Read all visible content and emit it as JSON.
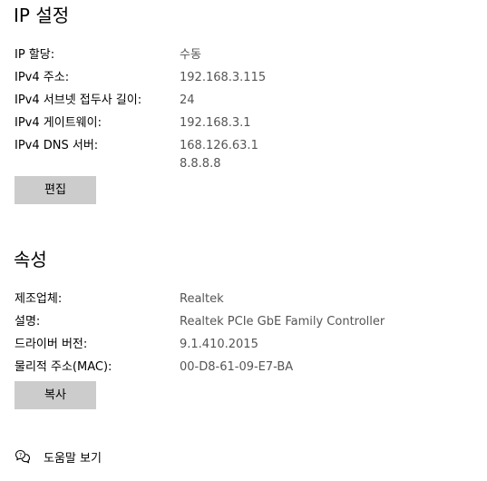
{
  "ip_settings": {
    "title": "IP 설정",
    "rows": [
      {
        "label": "IP 할당:",
        "value": "수동"
      },
      {
        "label": "IPv4 주소:",
        "value": "192.168.3.115"
      },
      {
        "label": "IPv4 서브넷 접두사 길이:",
        "value": "24"
      },
      {
        "label": "IPv4 게이트웨이:",
        "value": "192.168.3.1"
      },
      {
        "label": "IPv4 DNS 서버:",
        "value": "168.126.63.1",
        "value2": "8.8.8.8"
      }
    ],
    "edit_button": "편집"
  },
  "properties": {
    "title": "속성",
    "rows": [
      {
        "label": "제조업체:",
        "value": "Realtek"
      },
      {
        "label": "설명:",
        "value": "Realtek PCIe GbE Family Controller"
      },
      {
        "label": "드라이버 버전:",
        "value": "9.1.410.2015"
      },
      {
        "label": "물리적 주소(MAC):",
        "value": "00-D8-61-09-E7-BA"
      }
    ],
    "copy_button": "복사"
  },
  "help": {
    "label": "도움말 보기",
    "icon": "help-chat-icon"
  }
}
